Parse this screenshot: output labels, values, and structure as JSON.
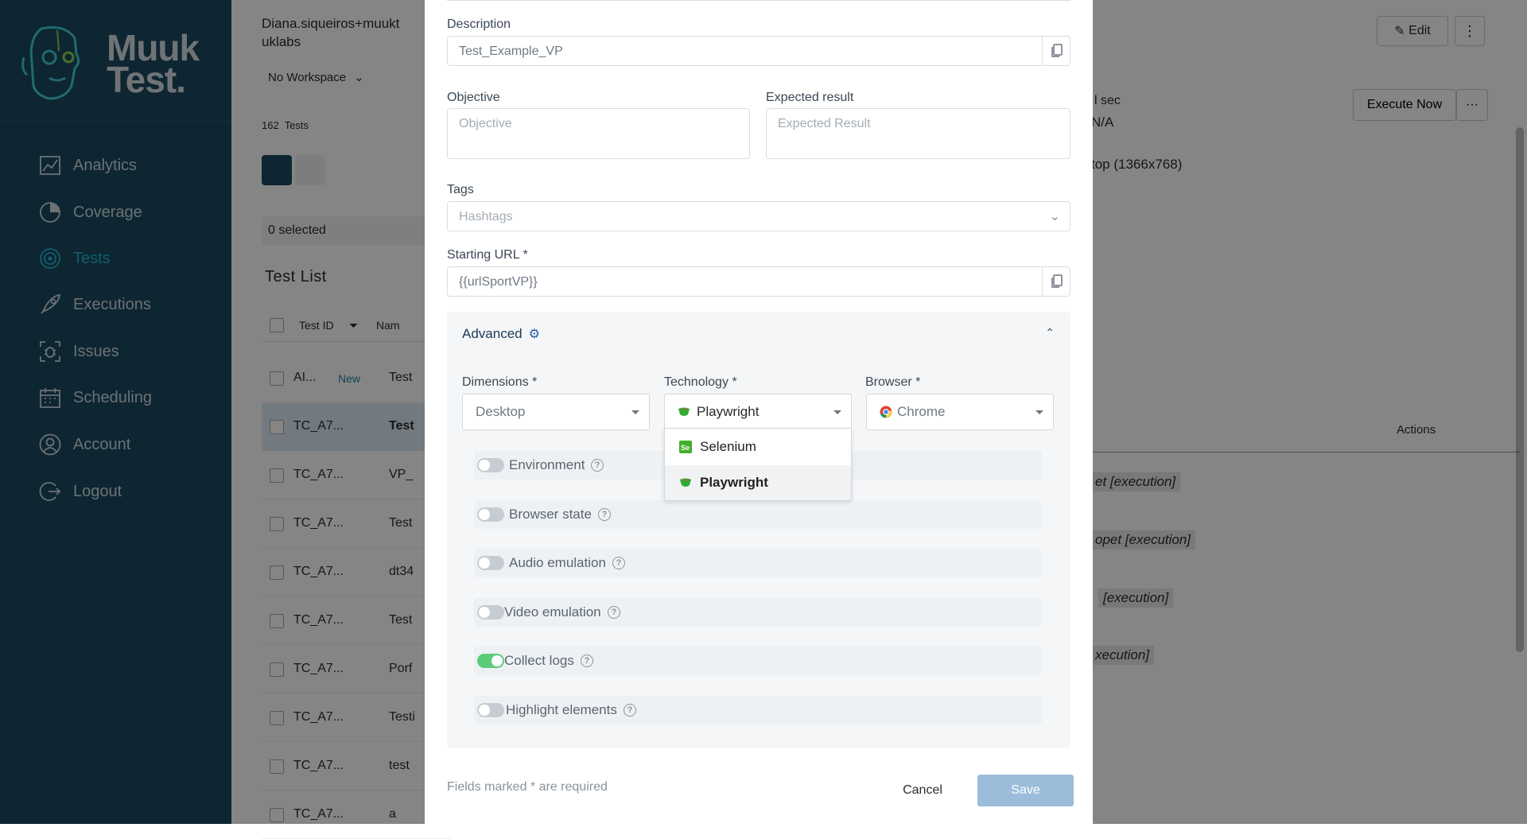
{
  "sidebar": {
    "brand": "Muuk Test",
    "items": [
      {
        "label": "Analytics",
        "icon": "analytics-icon"
      },
      {
        "label": "Coverage",
        "icon": "coverage-icon"
      },
      {
        "label": "Tests",
        "icon": "tests-icon",
        "active": true
      },
      {
        "label": "Executions",
        "icon": "rocket-icon"
      },
      {
        "label": "Issues",
        "icon": "bug-icon"
      },
      {
        "label": "Scheduling",
        "icon": "calendar-icon"
      },
      {
        "label": "Account",
        "icon": "user-icon"
      },
      {
        "label": "Logout",
        "icon": "logout-icon"
      }
    ]
  },
  "background": {
    "user_line1": "Diana.siqueiros+muukt",
    "user_line2": "uklabs",
    "workspace": "No Workspace",
    "tests_count": "162",
    "tests_label": "Tests",
    "selected": "0 selected",
    "list_title": "Test List",
    "col_test_id": "Test ID",
    "col_name": "Nam",
    "rows": [
      {
        "id": "AI...",
        "badge": "New",
        "name": "Test"
      },
      {
        "id": "TC_A7...",
        "name": "Test"
      },
      {
        "id": "TC_A7...",
        "name": "VP_"
      },
      {
        "id": "TC_A7...",
        "name": "Test"
      },
      {
        "id": "TC_A7...",
        "name": "dt34"
      },
      {
        "id": "TC_A7...",
        "name": "Test"
      },
      {
        "id": "TC_A7...",
        "name": "Porf"
      },
      {
        "id": "TC_A7...",
        "name": "Testi"
      },
      {
        "id": "TC_A7...",
        "name": "test"
      },
      {
        "id": "TC_A7...",
        "name": "a"
      }
    ],
    "edit_label": "Edit",
    "execute_now": "Execute Now",
    "sec_text": "l sec",
    "na_text": "N/A",
    "resolution": "top (1366x768)",
    "actions_label": "Actions",
    "exec_rows": [
      "et [execution]",
      "opet [execution]",
      "[execution]",
      "xecution]"
    ]
  },
  "modal": {
    "description_label": "Description",
    "description_value": "Test_Example_VP",
    "objective_label": "Objective",
    "objective_placeholder": "Objective",
    "expected_label": "Expected result",
    "expected_placeholder": "Expected Result",
    "tags_label": "Tags",
    "tags_placeholder": "Hashtags",
    "starting_url_label": "Starting URL *",
    "starting_url_value": "{{urlSportVP}}",
    "advanced_label": "Advanced",
    "dimensions_label": "Dimensions *",
    "dimensions_value": "Desktop",
    "technology_label": "Technology *",
    "technology_value": "Playwright",
    "technology_options": [
      "Selenium",
      "Playwright"
    ],
    "browser_label": "Browser *",
    "browser_value": "Chrome",
    "toggles": [
      {
        "label": "Environment",
        "on": false
      },
      {
        "label": "Browser state",
        "on": false
      },
      {
        "label": "Audio emulation",
        "on": false
      },
      {
        "label": "Video emulation",
        "on": false
      },
      {
        "label": "Collect logs",
        "on": true
      },
      {
        "label": "Highlight elements",
        "on": false
      }
    ],
    "required_note": "Fields marked * are required",
    "cancel_label": "Cancel",
    "save_label": "Save"
  },
  "colors": {
    "sidebar_bg": "#1a4a60",
    "active_nav": "#20b5d4",
    "toggle_on": "#5ccc7a",
    "save_btn": "#9bbdda"
  }
}
